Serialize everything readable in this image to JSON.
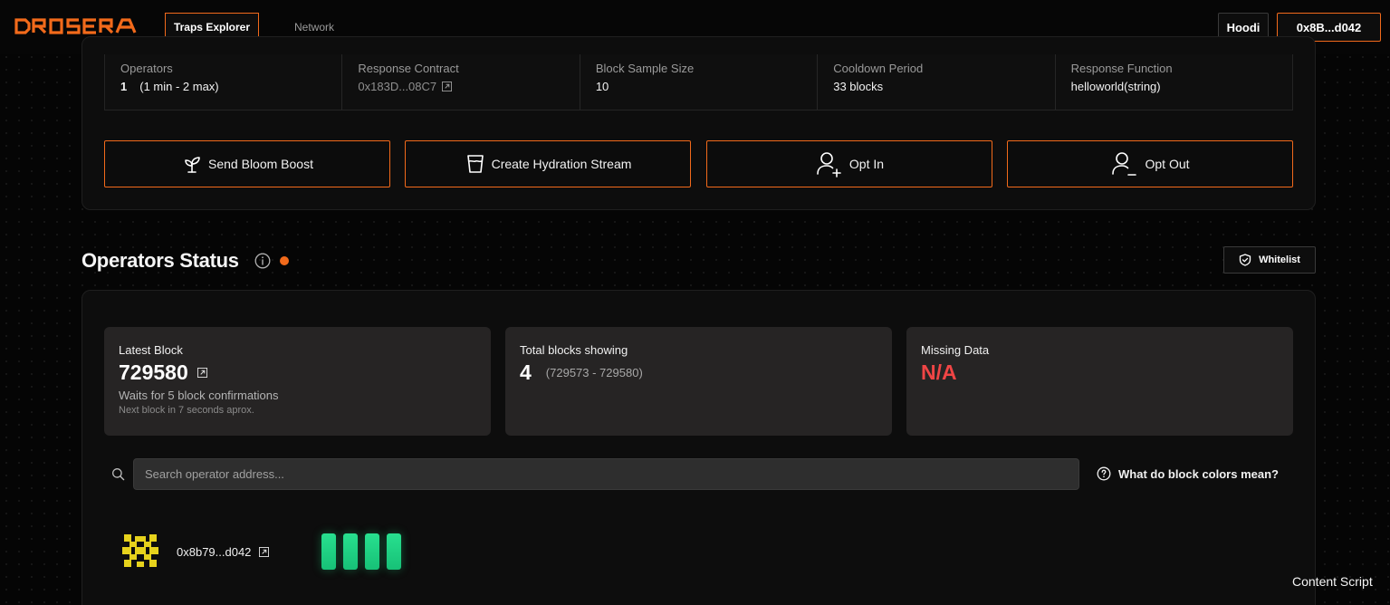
{
  "brand": {
    "logo_text": "DROSERA",
    "accent_color": "#f26a1b"
  },
  "nav": {
    "tabs": [
      {
        "label": "Traps Explorer",
        "active": true
      },
      {
        "label": "Network",
        "active": false
      }
    ],
    "network_label": "Hoodi",
    "wallet_label": "0x8B...d042"
  },
  "trap_config": {
    "items": [
      {
        "label": "Operators",
        "value_count": "1",
        "value_range": "(1 min - 2 max)"
      },
      {
        "label": "Response Contract",
        "value": "0x183D...08C7"
      },
      {
        "label": "Block Sample Size",
        "value": "10"
      },
      {
        "label": "Cooldown Period",
        "value": "33 blocks"
      },
      {
        "label": "Response Function",
        "value": "helloworld(string)"
      }
    ]
  },
  "actions": [
    {
      "label": "Send Bloom Boost",
      "icon": "sprout-icon"
    },
    {
      "label": "Create Hydration Stream",
      "icon": "cup-icon"
    },
    {
      "label": "Opt In",
      "icon": "user-plus-icon"
    },
    {
      "label": "Opt Out",
      "icon": "user-minus-icon"
    }
  ],
  "operators_status": {
    "title": "Operators Status",
    "whitelist_label": "Whitelist",
    "status_color": "#f26a1b"
  },
  "stats": {
    "latest_block": {
      "label": "Latest Block",
      "value": "729580",
      "confirmations": "Waits for 5 block confirmations",
      "next_block": "Next block in 7 seconds aprox."
    },
    "total_blocks": {
      "label": "Total blocks showing",
      "value": "4",
      "range": "(729573 - 729580)"
    },
    "missing_data": {
      "label": "Missing Data",
      "value": "N/A",
      "value_color": "#f04545"
    }
  },
  "search": {
    "placeholder": "Search operator address..."
  },
  "help": {
    "colors_label": "What do block colors mean?"
  },
  "operators": [
    {
      "address": "0x8b79...d042",
      "blocks": [
        "ok",
        "ok",
        "ok",
        "ok"
      ],
      "block_color": "#1fd080"
    }
  ],
  "overlay": {
    "content_script_label": "Content Script"
  }
}
